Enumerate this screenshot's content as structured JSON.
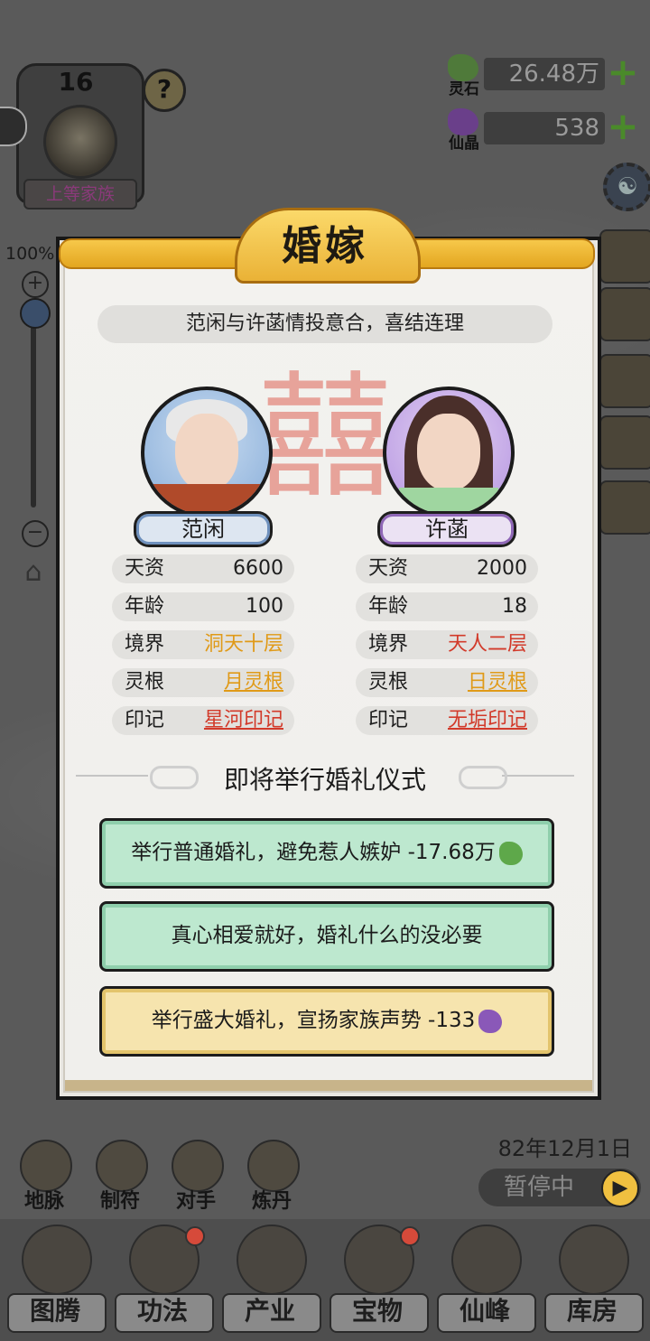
{
  "family": {
    "level": "16",
    "rank": "上等家族",
    "help": "?"
  },
  "zoom": {
    "percent": "100%",
    "plus": "+",
    "minus": "−"
  },
  "currency": [
    {
      "name": "灵石",
      "value": "26.48万",
      "icon": "spirit-stone-icon",
      "color": "#4f7a3a"
    },
    {
      "name": "仙晶",
      "value": "538",
      "icon": "immortal-crystal-icon",
      "color": "#6a3f8a"
    }
  ],
  "dialog": {
    "title": "婚嫁",
    "subtitle": "范闲与许菡情投意合，喜结连理",
    "emblem": "囍",
    "left": {
      "name": "范闲",
      "stats": [
        {
          "k": "天资",
          "v": "6600"
        },
        {
          "k": "年龄",
          "v": "100"
        },
        {
          "k": "境界",
          "v": "洞天十层"
        },
        {
          "k": "灵根",
          "v": "月灵根"
        },
        {
          "k": "印记",
          "v": "星河印记"
        }
      ]
    },
    "right": {
      "name": "许菡",
      "stats": [
        {
          "k": "天资",
          "v": "2000"
        },
        {
          "k": "年龄",
          "v": "18"
        },
        {
          "k": "境界",
          "v": "天人二层"
        },
        {
          "k": "灵根",
          "v": "日灵根"
        },
        {
          "k": "印记",
          "v": "无垢印记"
        }
      ]
    },
    "section": "即将举行婚礼仪式",
    "options": [
      {
        "text": "举行普通婚礼，避免惹人嫉妒 -17.68万",
        "cost_icon": "spirit-stone-icon"
      },
      {
        "text": "真心相爱就好，婚礼什么的没必要"
      },
      {
        "text": "举行盛大婚礼，宣扬家族声势 -133",
        "cost_icon": "immortal-crystal-icon"
      }
    ]
  },
  "date": "82年12月1日",
  "pause": "暂停中",
  "mini_actions": [
    "地脉",
    "制符",
    "对手",
    "炼丹"
  ],
  "nav": [
    "图腾",
    "功法",
    "产业",
    "宝物",
    "仙峰",
    "库房"
  ]
}
